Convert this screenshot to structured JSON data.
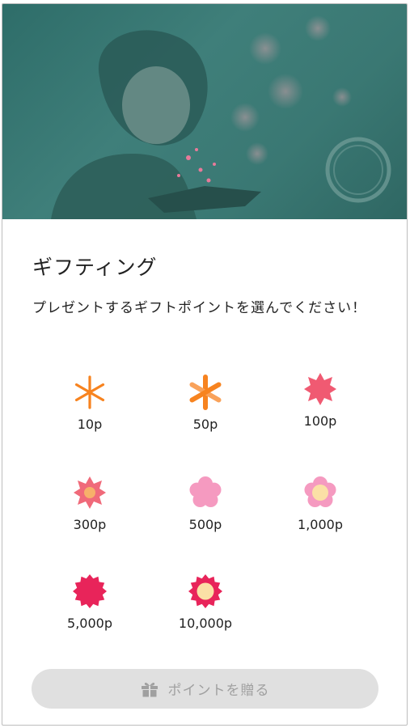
{
  "dialog": {
    "title": "ギフティング",
    "description": "プレゼントするギフトポイントを選んでください！"
  },
  "gifts": [
    {
      "label": "10p",
      "icon": "orange-asterisk-icon",
      "color": "#f7831f"
    },
    {
      "label": "50p",
      "icon": "orange-bold-asterisk-icon",
      "color": "#f7831f"
    },
    {
      "label": "100p",
      "icon": "pink-star-burst-icon",
      "color": "#f05a72"
    },
    {
      "label": "300p",
      "icon": "pink-sunburst-icon",
      "color": "#f06a7a"
    },
    {
      "label": "500p",
      "icon": "light-pink-flower-icon",
      "color": "#f59ac0"
    },
    {
      "label": "1,000p",
      "icon": "pink-flower-cream-center-icon",
      "color": "#f59ac0"
    },
    {
      "label": "5,000p",
      "icon": "crimson-burst-icon",
      "color": "#e8245a"
    },
    {
      "label": "10,000p",
      "icon": "crimson-burst-cream-center-icon",
      "color": "#e8245a"
    }
  ],
  "send_button": {
    "label": "ポイントを贈る",
    "icon": "gift-box-icon"
  }
}
